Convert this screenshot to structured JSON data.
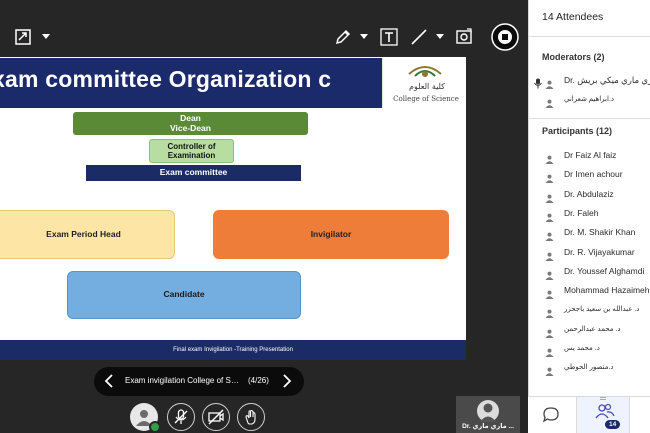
{
  "icons": {
    "fullscreen": "expand-icon",
    "pen": "pen-icon",
    "text": "text-tool-icon",
    "line": "line-tool-icon",
    "screenshot": "capture-icon",
    "stop_share": "stop-share-icon"
  },
  "slide": {
    "title": "xam committee Organization c",
    "logo_ar": "كلية العلوم",
    "logo_en": "College of Science",
    "dean": "Dean",
    "vice_dean": "Vice-Dean",
    "controller": "Controller of Examination",
    "committee": "Exam committee",
    "period_head": "Exam Period Head",
    "invigilator": "Invigilator",
    "candidate": "Candidate",
    "footer": "Final exam Invigilation -Training Presentation"
  },
  "navigator": {
    "title": "Exam invigilation College of Sci...",
    "counter": "(4/26)"
  },
  "speaker": {
    "name": "Dr. ماري ماري ..."
  },
  "panel": {
    "title": "14 Attendees",
    "moderators_label": "Moderators (2)",
    "participants_label": "Participants (12)",
    "moderators": [
      "Dr. ماري ماري ميكي بريش",
      "د.ابراهيم شعراني"
    ],
    "participants": [
      "Dr Faiz Al faiz",
      "Dr Imen achour",
      "Dr. Abdulaziz",
      "Dr. Faleh",
      "Dr. M. Shakir Khan",
      "Dr. R. Vijayakumar",
      "Dr. Youssef Alghamdi",
      "Mohammad Hazaimeh",
      "د. عبدالله بن سعيد باجحزر",
      "د. محمد عبدالرحمن",
      "د. محمد يس",
      "د.منصور الحوطي"
    ],
    "attendee_badge": "14"
  },
  "colors": {
    "stage_bg": "#262626",
    "slide_navy": "#1b2b66",
    "dean_green": "#5a8a36",
    "controller_green": "#b7dda0",
    "period_yellow": "#fde5a6",
    "invigilator_orange": "#ee7d3a",
    "candidate_blue": "#74aee0",
    "status_green": "#2e9e4f"
  }
}
